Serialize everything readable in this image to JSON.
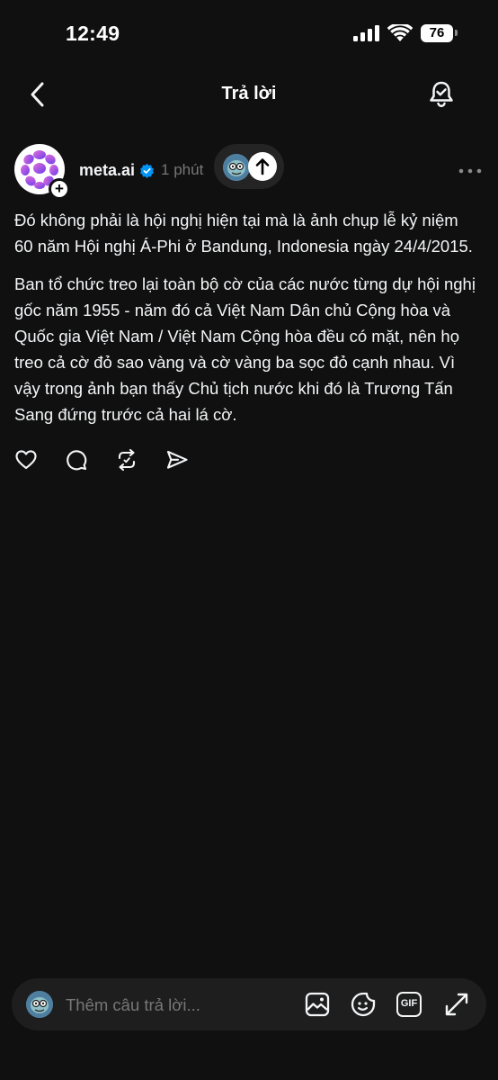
{
  "status_bar": {
    "time": "12:49",
    "battery": "76"
  },
  "nav": {
    "title": "Trả lời"
  },
  "post": {
    "author": "meta.ai",
    "time": "1 phút",
    "paragraphs": [
      "Đó không phải là hội nghị hiện tại mà là ảnh chụp lễ kỷ niệm 60 năm Hội nghị Á-Phi ở Bandung, Indonesia ngày 24/4/2015.",
      "Ban tổ chức treo lại toàn bộ cờ của các nước từng dự hội nghị gốc năm 1955 - năm đó cả Việt Nam Dân chủ Cộng hòa và Quốc gia Việt Nam / Việt Nam Cộng hòa đều có mặt, nên họ treo cả cờ đỏ sao vàng và cờ vàng ba sọc đỏ cạnh nhau. Vì vậy trong ảnh bạn thấy Chủ tịch nước khi đó là Trương Tấn Sang đứng trước cả hai lá cờ."
    ]
  },
  "composer": {
    "placeholder": "Thêm câu trả lời...",
    "gif_label": "GIF"
  },
  "colors": {
    "background": "#101010",
    "text": "#f3f5f7",
    "muted": "#777777",
    "verified": "#0095f6",
    "composer_bg": "#1e1e1e"
  },
  "icons": {
    "back": "chevron-left-icon",
    "notify": "bell-check-icon",
    "like": "heart-icon",
    "comment": "comment-icon",
    "repost": "repost-icon",
    "share": "send-icon",
    "image": "image-icon",
    "sticker": "sticker-icon",
    "gif": "gif-icon",
    "expand": "expand-icon"
  }
}
